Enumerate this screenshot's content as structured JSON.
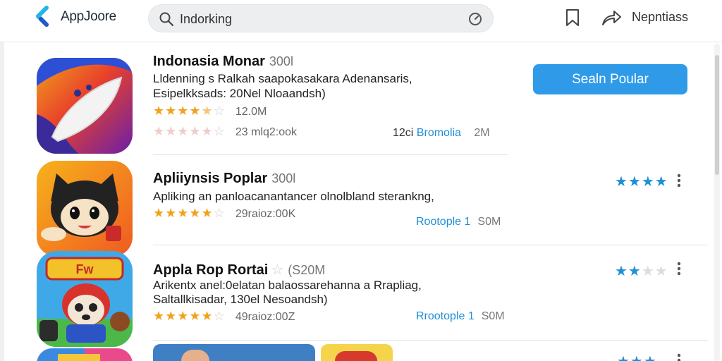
{
  "header": {
    "brand": "AppJoore",
    "search_value": "Indorking",
    "account_label": "Nepntiass"
  },
  "featured": {
    "title": "Indonasia Monar",
    "title_meta": "300l",
    "desc_line1": "Lldenning s Ralkah saapokasakara Adenansaris,",
    "desc_line2": "Esipelkksads: 20Nel Nloaandsh)",
    "stars_filled": 4.5,
    "rating_count": "12.0M",
    "faint_count": "23 mlq2:ook",
    "link_label": "Bromolia",
    "link_prefix": "12ci",
    "link_size": "2M",
    "button_label": "Sealn Poular"
  },
  "apps": [
    {
      "title": "Apliiynsis Poplar",
      "title_meta": "300l",
      "desc_line1": "Apliking an panloacanantancer olnolbland sterankng,",
      "desc_line2": "",
      "stars_filled": 4.5,
      "rating_count": "29raioz:00K",
      "link_label": "Rootople 1",
      "link_size": "S0M",
      "mini_rating": 4
    },
    {
      "title": "Appla Rop Rortai",
      "title_meta": "(S20M",
      "desc_line1": "Arikentx anel:0elatan balaossarehanna a Rrapliag,",
      "desc_line2": "Saltallkisadar, 130el Nesoandsh)",
      "stars_filled": 4.5,
      "rating_count": "49raioz:00Z",
      "link_label": "Rrootople 1",
      "link_size": "S0M",
      "mini_rating": 2
    }
  ],
  "colors": {
    "accent": "#2f9be8",
    "star": "#f0a21b",
    "link": "#1f8fd6"
  }
}
